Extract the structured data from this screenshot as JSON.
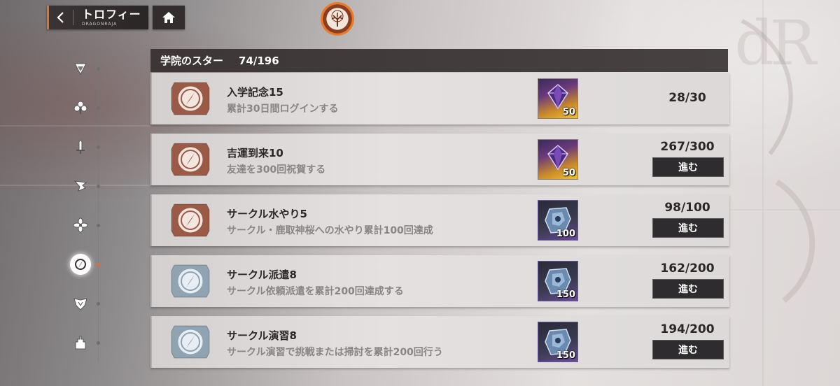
{
  "topbar": {
    "back_icon": "chevron-left-icon",
    "title": "トロフィー",
    "subtitle": "DRAGONRAJA",
    "home_icon": "home-icon",
    "accent": "#d4752e"
  },
  "emblem": {
    "icon": "tree-emblem-icon"
  },
  "sidenav": {
    "items": [
      {
        "icon": "triangle-crest-icon",
        "active": false
      },
      {
        "icon": "club-icon",
        "active": false
      },
      {
        "icon": "sword-icon",
        "active": false
      },
      {
        "icon": "wing-icon",
        "active": false
      },
      {
        "icon": "flower-icon",
        "active": false
      },
      {
        "icon": "compass-icon",
        "active": true
      },
      {
        "icon": "crest-icon",
        "active": false
      },
      {
        "icon": "castle-icon",
        "active": false
      }
    ]
  },
  "panel": {
    "header_title": "学院のスター",
    "header_count": "74/196",
    "rows": [
      {
        "name": "入学記念15",
        "desc": "累計30日間ログインする",
        "badge": "bronze",
        "reward_type": "gem",
        "reward_icon": "purple-gem-icon",
        "reward_qty": "50",
        "progress": "28/30",
        "has_button": false,
        "button_label": ""
      },
      {
        "name": "吉運到来10",
        "desc": "友達を300回祝賀する",
        "badge": "bronze",
        "reward_type": "gem",
        "reward_icon": "purple-gem-icon",
        "reward_qty": "50",
        "progress": "267/300",
        "has_button": true,
        "button_label": "進む"
      },
      {
        "name": "サークル水やり5",
        "desc": "サークル・鹿取神桜への水やり累計100回達成",
        "badge": "bronze",
        "reward_type": "ore",
        "reward_icon": "blue-ore-icon",
        "reward_qty": "100",
        "progress": "98/100",
        "has_button": true,
        "button_label": "進む"
      },
      {
        "name": "サークル派遣8",
        "desc": "サークル依頼派遣を累計200回達成する",
        "badge": "silver",
        "reward_type": "ore",
        "reward_icon": "blue-ore-icon",
        "reward_qty": "150",
        "progress": "162/200",
        "has_button": true,
        "button_label": "進む"
      },
      {
        "name": "サークル演習8",
        "desc": "サークル演習で挑戦または掃討を累計200回行う",
        "badge": "silver",
        "reward_type": "ore",
        "reward_icon": "blue-ore-icon",
        "reward_qty": "150",
        "progress": "194/200",
        "has_button": true,
        "button_label": "進む"
      }
    ]
  },
  "colors": {
    "bronze_badge": "#9a5a46",
    "silver_badge": "#8fa3b3",
    "active_nav": "#e06a3a"
  }
}
